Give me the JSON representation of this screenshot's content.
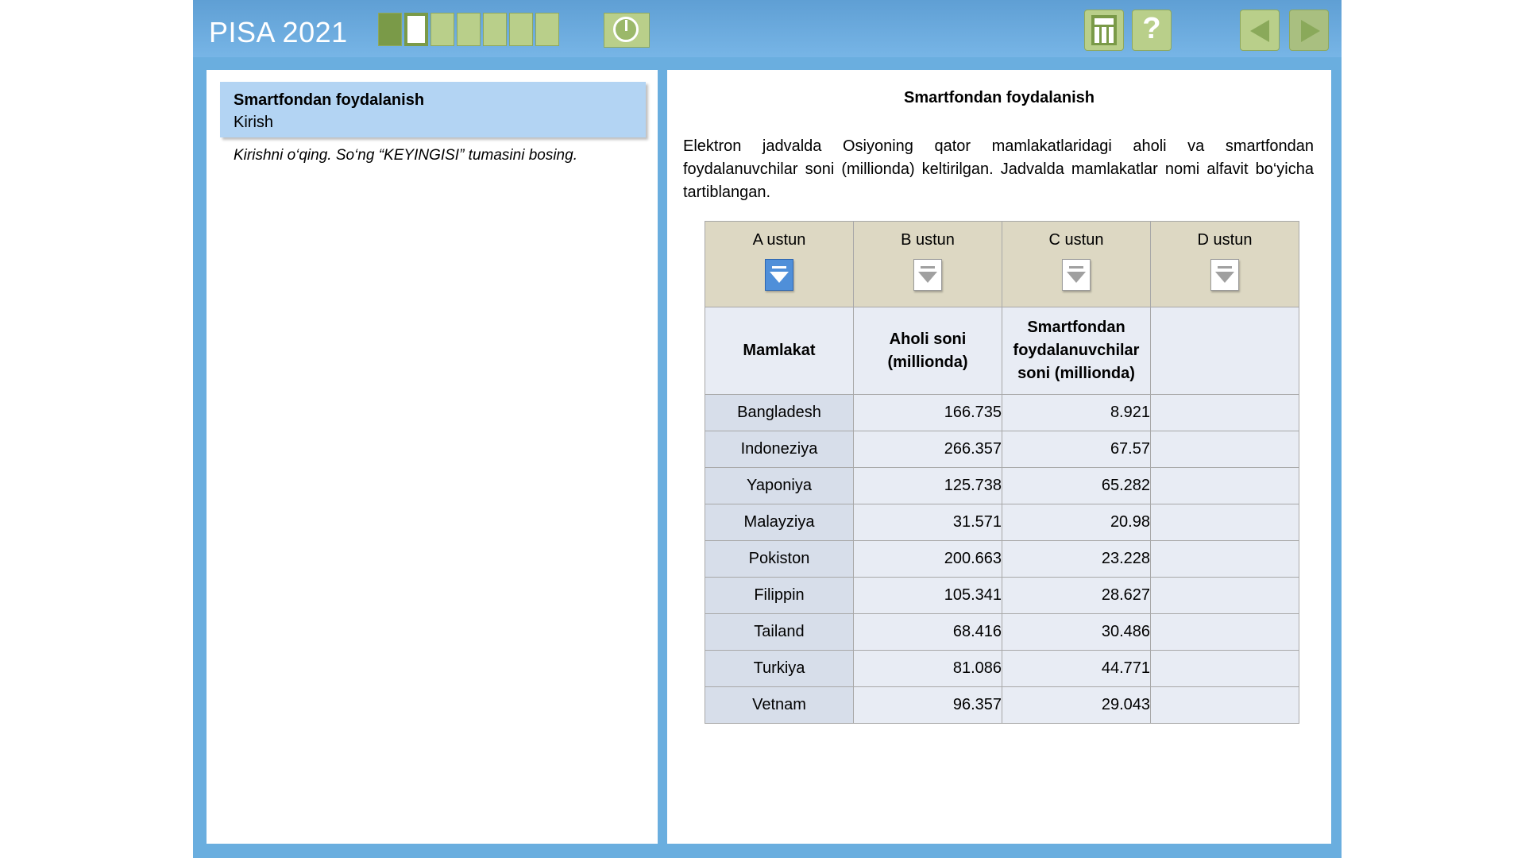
{
  "header": {
    "title": "PISA 2021",
    "progress": {
      "total": 7,
      "current": 2
    },
    "tools": {
      "calculator": "calculator-icon",
      "help": "?",
      "back": "back-arrow-icon",
      "next": "next-arrow-icon"
    }
  },
  "intro": {
    "title": "Smartfondan foydalanish",
    "subtitle": "Kirish",
    "instruction": "Kirishni o‘qing. So‘ng “KEYINGISI” tumasini bosing."
  },
  "content": {
    "title": "Smartfondan foydalanish",
    "description": "Elektron jadvalda Osiyoning qator mamlakatlaridagi aholi va smartfondan foydalanuvchilar soni (millionda) keltirilgan. Jadvalda mamlakatlar nomi alfavit bo‘yicha tartiblangan."
  },
  "sheet": {
    "columns": [
      "A ustun",
      "B ustun",
      "C ustun",
      "D ustun"
    ],
    "active_sort_column": 0,
    "headers": [
      "Mamlakat",
      "Aholi soni (millionda)",
      "Smartfondan foydalanuvchilar soni (millionda)",
      ""
    ],
    "rows": [
      [
        "Bangladesh",
        "166.735",
        "8.921"
      ],
      [
        "Indoneziya",
        "266.357",
        "67.57"
      ],
      [
        "Yaponiya",
        "125.738",
        "65.282"
      ],
      [
        "Malayziya",
        "31.571",
        "20.98"
      ],
      [
        "Pokiston",
        "200.663",
        "23.228"
      ],
      [
        "Filippin",
        "105.341",
        "28.627"
      ],
      [
        "Tailand",
        "68.416",
        "30.486"
      ],
      [
        "Turkiya",
        "81.086",
        "44.771"
      ],
      [
        "Vetnam",
        "96.357",
        "29.043"
      ]
    ]
  }
}
